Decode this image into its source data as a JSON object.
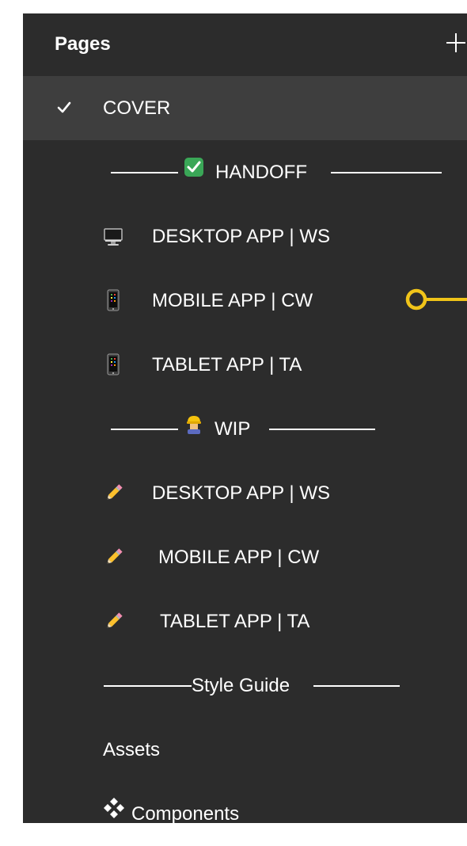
{
  "header": {
    "title": "Pages",
    "add_icon": "plus-icon"
  },
  "pages": {
    "selected": {
      "label": "COVER",
      "icon": "checkmark-icon"
    },
    "handoff_divider": {
      "label": "HANDOFF",
      "icon": "green-check-box-icon"
    },
    "handoff_items": [
      {
        "label": "DESKTOP APP | WS",
        "icon": "desktop-computer-icon"
      },
      {
        "label": "MOBILE APP | CW",
        "icon": "mobile-phone-icon"
      },
      {
        "label": "TABLET APP | TA",
        "icon": "mobile-phone-icon"
      }
    ],
    "wip_divider": {
      "label": "WIP",
      "icon": "construction-worker-icon"
    },
    "wip_items": [
      {
        "label": "DESKTOP APP | WS",
        "icon": "pencil-icon"
      },
      {
        "label": "MOBILE APP | CW",
        "icon": "pencil-icon"
      },
      {
        "label": "TABLET APP | TA",
        "icon": "pencil-icon"
      }
    ],
    "style_divider": {
      "label": "Style Guide"
    },
    "style_items": [
      {
        "label": "Assets"
      },
      {
        "label": "Components",
        "icon": "four-diamonds-icon"
      }
    ]
  },
  "colors": {
    "panel_background": "#2c2c2c",
    "selected_row": "#3e3e3e",
    "text": "#ffffff",
    "connector": "#f0c419"
  }
}
